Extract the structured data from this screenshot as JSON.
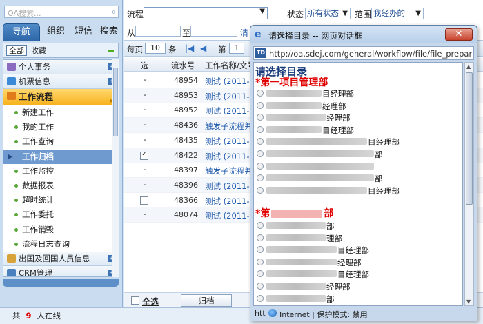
{
  "sidebar": {
    "search_placeholder": "OA搜索...",
    "tabs": [
      "导航",
      "组织",
      "短信",
      "搜索"
    ],
    "sub": {
      "all": "全部",
      "fav": "收藏"
    },
    "sections_top": [
      {
        "label": "个人事务",
        "icon_color": "#8a6bbf"
      },
      {
        "label": "机票信息",
        "icon_color": "#3a8ad8"
      }
    ],
    "active_section": "工作流程",
    "items": [
      "新建工作",
      "我的工作",
      "工作查询",
      "工作归档",
      "工作监控",
      "数据报表",
      "超时统计",
      "工作委托",
      "工作销毁",
      "流程日志查询"
    ],
    "selected_index": 3,
    "sections_bottom": [
      {
        "label": "出国及回国人员信息",
        "icon_color": "#d8a33a"
      },
      {
        "label": "CRM管理",
        "icon_color": "#4a7fc0"
      }
    ]
  },
  "status": {
    "prefix": "共",
    "count": "9",
    "suffix": "人在线"
  },
  "filter": {
    "flow_label": "流程",
    "status_label": "状态",
    "status_value": "所有状态",
    "range_label": "范围",
    "range_value": "我经办的",
    "from_label": "从",
    "to_label": "至",
    "query_link": "清"
  },
  "pager": {
    "per_page_label": "每页",
    "per_page": "10",
    "unit": "条",
    "page_label": "第",
    "page": "1"
  },
  "grid": {
    "headers": {
      "select": "选",
      "serial": "流水号",
      "name": "工作名称/文号"
    },
    "rows": [
      {
        "sel": "-",
        "num": "48954",
        "name": "测试 (2011-02"
      },
      {
        "sel": "-",
        "num": "48953",
        "name": "测试 (2011-02"
      },
      {
        "sel": "-",
        "num": "48952",
        "name": "测试 (2011-02"
      },
      {
        "sel": "-",
        "num": "48436",
        "name": "触发子流程并"
      },
      {
        "sel": "-",
        "num": "48435",
        "name": "测试 (2011-01"
      },
      {
        "sel": "checked",
        "num": "48422",
        "name": "测试 (2011-01"
      },
      {
        "sel": "-",
        "num": "48397",
        "name": "触发子流程并"
      },
      {
        "sel": "-",
        "num": "48396",
        "name": "测试 (2011-01"
      },
      {
        "sel": "box",
        "num": "48366",
        "name": "测试 (2011-01"
      },
      {
        "sel": "-",
        "num": "48074",
        "name": "测试 (2011-01"
      }
    ],
    "select_all": "全选",
    "archive_button": "归档"
  },
  "dialog": {
    "title": "请选择目录 -- 网页对话框",
    "close": "✕",
    "url": "http://oa.sdej.com/general/workflow/file/file_prepare_p",
    "heading": "请选择目录",
    "group1": "*第一项目管理部",
    "group1_items": [
      "目经理部",
      "经理部",
      "经理部",
      "目经理部",
      "目经理部",
      "部",
      "",
      "部",
      "目经理部"
    ],
    "group2": "*第",
    "group2_tail": "部",
    "group2_items": [
      "部",
      "理部",
      "目经理部",
      "经理部",
      "目经理部",
      "经理部",
      "部"
    ],
    "status_prefix": "htt",
    "status_zone": "Internet | 保护模式: 禁用"
  }
}
